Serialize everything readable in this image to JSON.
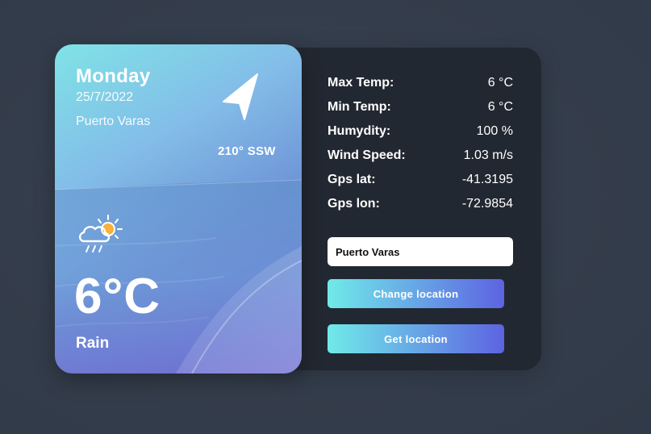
{
  "card": {
    "day": "Monday",
    "date": "25/7/2022",
    "city": "Puerto Varas",
    "wind": "210° SSW",
    "temperature": "6°C",
    "condition": "Rain",
    "icons": {
      "direction": "navigation-arrow-icon",
      "weather": "rain-sun-cloud-icon"
    }
  },
  "stats": [
    {
      "label": "Max Temp:",
      "value": "6 °C"
    },
    {
      "label": "Min Temp:",
      "value": "6 °C"
    },
    {
      "label": "Humydity:",
      "value": "100 %"
    },
    {
      "label": "Wind Speed:",
      "value": "1.03 m/s"
    },
    {
      "label": "Gps lat:",
      "value": "-41.3195"
    },
    {
      "label": "Gps lon:",
      "value": "-72.9854"
    }
  ],
  "location_input": {
    "value": "Puerto Varas"
  },
  "buttons": {
    "change_location": "Change location",
    "get_location": "Get location"
  },
  "colors": {
    "page_bg": "#343d4b",
    "panel_bg": "#222831",
    "button_gradient_start": "#70eae9",
    "button_gradient_end": "#5d63e2",
    "card_gradient_start": "#7fe3e6",
    "card_gradient_end": "#6c74d4"
  }
}
